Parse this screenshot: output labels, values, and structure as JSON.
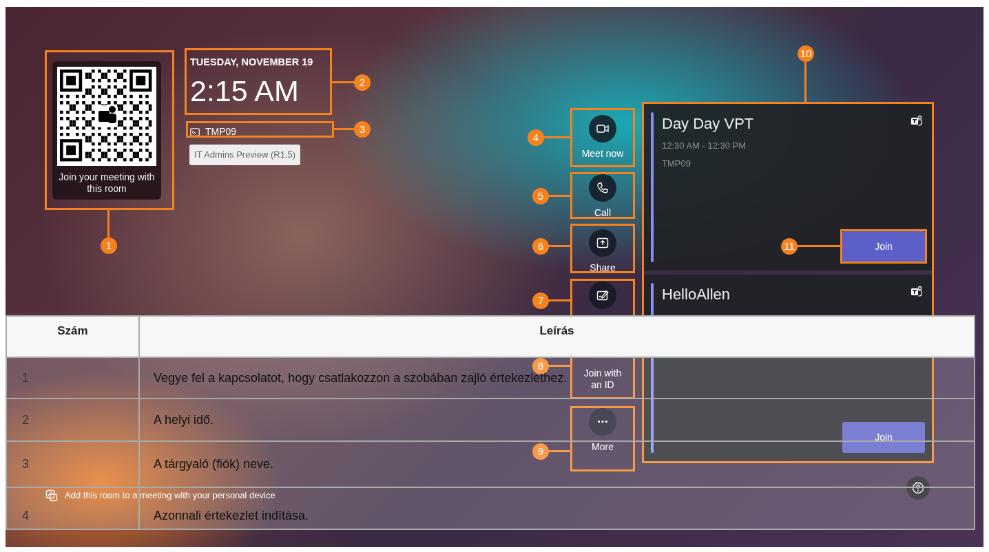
{
  "qr_card": {
    "caption": "Join your meeting with this room"
  },
  "clock": {
    "date": "TUESDAY, NOVEMBER 19",
    "time": "2:15 AM"
  },
  "room": {
    "name": "TMP09"
  },
  "build_badge": "IT Admins Preview (R1.5)",
  "actions": [
    {
      "kind": "video",
      "label": "Meet now"
    },
    {
      "kind": "phone",
      "label": "Call"
    },
    {
      "kind": "share",
      "label": "Share"
    },
    {
      "kind": "whiteboard"
    },
    {
      "label": "Join with an ID"
    },
    {
      "kind": "more",
      "label": "More"
    }
  ],
  "meetings": [
    {
      "title": "Day Day VPT",
      "time": "12:30 AM - 12:30 PM",
      "room": "TMP09",
      "join": "Join"
    },
    {
      "title": "HelloAllen",
      "join": "Join"
    }
  ],
  "footer": {
    "text": "Add this room to a meeting with your personal device"
  },
  "callouts": [
    "1",
    "2",
    "3",
    "4",
    "5",
    "6",
    "7",
    "8",
    "9",
    "10",
    "11"
  ],
  "table": {
    "columns": [
      "Szám",
      "Leírás"
    ],
    "rows": [
      [
        "1",
        "Vegye fel a kapcsolatot, hogy csatlakozzon a szobában zajló értekezlethez."
      ],
      [
        "2",
        "A helyi idő."
      ],
      [
        "3",
        "A tárgyaló (fiók) neve."
      ],
      [
        "4",
        "Azonnali értekezlet indítása."
      ]
    ]
  }
}
